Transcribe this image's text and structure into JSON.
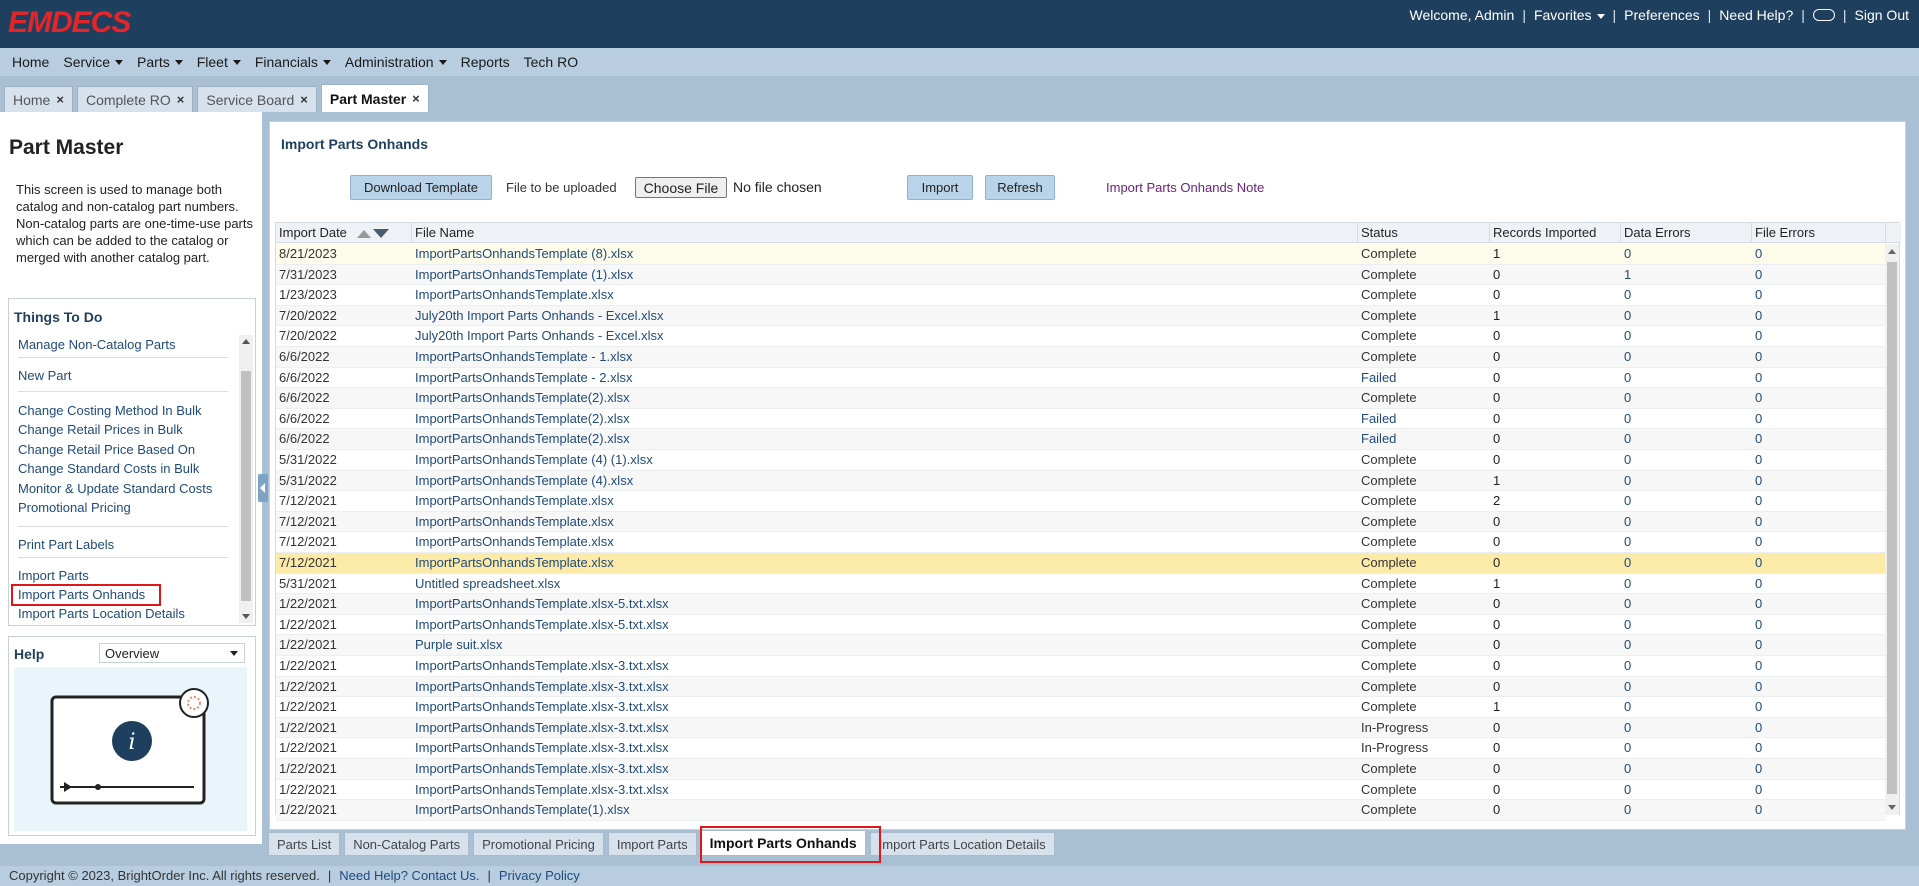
{
  "header": {
    "logo": "EMDECS",
    "welcome": "Welcome, Admin",
    "favorites": "Favorites",
    "preferences": "Preferences",
    "need_help": "Need Help?",
    "sign_out": "Sign Out"
  },
  "menu": [
    {
      "label": "Home",
      "dropdown": false
    },
    {
      "label": "Service",
      "dropdown": true
    },
    {
      "label": "Parts",
      "dropdown": true
    },
    {
      "label": "Fleet",
      "dropdown": true
    },
    {
      "label": "Financials",
      "dropdown": true
    },
    {
      "label": "Administration",
      "dropdown": true
    },
    {
      "label": "Reports",
      "dropdown": false
    },
    {
      "label": "Tech RO",
      "dropdown": false
    }
  ],
  "tabs": [
    {
      "label": "Home",
      "active": false
    },
    {
      "label": "Complete RO",
      "active": false
    },
    {
      "label": "Service Board",
      "active": false
    },
    {
      "label": "Part Master",
      "active": true
    }
  ],
  "left": {
    "title": "Part Master",
    "description": "This screen is used to manage both catalog and non-catalog part numbers. Non-catalog parts are one-time-use parts which can be added to the catalog or merged with another catalog part.",
    "todo_title": "Things To Do",
    "todo_items": [
      "Manage Non-Catalog Parts",
      "New Part",
      "Change Costing Method In Bulk",
      "Change Retail Prices in Bulk",
      "Change Retail Price Based On",
      "Change Standard Costs in Bulk",
      "Monitor & Update Standard Costs",
      "Promotional Pricing",
      "Print Part Labels",
      "Import Parts",
      "Import Parts Onhands",
      "Import Parts Location Details"
    ],
    "help_title": "Help",
    "help_select": "Overview"
  },
  "main": {
    "title": "Import Parts Onhands",
    "download_label": "Download Template",
    "file_label": "File to be uploaded",
    "choose_label": "Choose File",
    "no_file": "No file chosen",
    "import_label": "Import",
    "refresh_label": "Refresh",
    "note_label": "Import Parts Onhands Note"
  },
  "table": {
    "headers": [
      "Import Date",
      "File Name",
      "Status",
      "Records Imported",
      "Data Errors",
      "File Errors"
    ],
    "rows": [
      [
        "8/21/2023",
        "ImportPartsOnhandsTemplate (8).xlsx",
        "Complete",
        "1",
        "0",
        "0"
      ],
      [
        "7/31/2023",
        "ImportPartsOnhandsTemplate (1).xlsx",
        "Complete",
        "0",
        "1",
        "0"
      ],
      [
        "1/23/2023",
        "ImportPartsOnhandsTemplate.xlsx",
        "Complete",
        "0",
        "0",
        "0"
      ],
      [
        "7/20/2022",
        "July20th Import Parts Onhands - Excel.xlsx",
        "Complete",
        "1",
        "0",
        "0"
      ],
      [
        "7/20/2022",
        "July20th Import Parts Onhands - Excel.xlsx",
        "Complete",
        "0",
        "0",
        "0"
      ],
      [
        "6/6/2022",
        "ImportPartsOnhandsTemplate - 1.xlsx",
        "Complete",
        "0",
        "0",
        "0"
      ],
      [
        "6/6/2022",
        "ImportPartsOnhandsTemplate - 2.xlsx",
        "Failed",
        "0",
        "0",
        "0"
      ],
      [
        "6/6/2022",
        "ImportPartsOnhandsTemplate(2).xlsx",
        "Complete",
        "0",
        "0",
        "0"
      ],
      [
        "6/6/2022",
        "ImportPartsOnhandsTemplate(2).xlsx",
        "Failed",
        "0",
        "0",
        "0"
      ],
      [
        "6/6/2022",
        "ImportPartsOnhandsTemplate(2).xlsx",
        "Failed",
        "0",
        "0",
        "0"
      ],
      [
        "5/31/2022",
        "ImportPartsOnhandsTemplate (4) (1).xlsx",
        "Complete",
        "0",
        "0",
        "0"
      ],
      [
        "5/31/2022",
        "ImportPartsOnhandsTemplate (4).xlsx",
        "Complete",
        "1",
        "0",
        "0"
      ],
      [
        "7/12/2021",
        "ImportPartsOnhandsTemplate.xlsx",
        "Complete",
        "2",
        "0",
        "0"
      ],
      [
        "7/12/2021",
        "ImportPartsOnhandsTemplate.xlsx",
        "Complete",
        "0",
        "0",
        "0"
      ],
      [
        "7/12/2021",
        "ImportPartsOnhandsTemplate.xlsx",
        "Complete",
        "0",
        "0",
        "0"
      ],
      [
        "7/12/2021",
        "ImportPartsOnhandsTemplate.xlsx",
        "Complete",
        "0",
        "0",
        "0"
      ],
      [
        "5/31/2021",
        "Untitled spreadsheet.xlsx",
        "Complete",
        "1",
        "0",
        "0"
      ],
      [
        "1/22/2021",
        "ImportPartsOnhandsTemplate.xlsx-5.txt.xlsx",
        "Complete",
        "0",
        "0",
        "0"
      ],
      [
        "1/22/2021",
        "ImportPartsOnhandsTemplate.xlsx-5.txt.xlsx",
        "Complete",
        "0",
        "0",
        "0"
      ],
      [
        "1/22/2021",
        "Purple suit.xlsx",
        "Complete",
        "0",
        "0",
        "0"
      ],
      [
        "1/22/2021",
        "ImportPartsOnhandsTemplate.xlsx-3.txt.xlsx",
        "Complete",
        "0",
        "0",
        "0"
      ],
      [
        "1/22/2021",
        "ImportPartsOnhandsTemplate.xlsx-3.txt.xlsx",
        "Complete",
        "0",
        "0",
        "0"
      ],
      [
        "1/22/2021",
        "ImportPartsOnhandsTemplate.xlsx-3.txt.xlsx",
        "Complete",
        "1",
        "0",
        "0"
      ],
      [
        "1/22/2021",
        "ImportPartsOnhandsTemplate.xlsx-3.txt.xlsx",
        "In-Progress",
        "0",
        "0",
        "0"
      ],
      [
        "1/22/2021",
        "ImportPartsOnhandsTemplate.xlsx-3.txt.xlsx",
        "In-Progress",
        "0",
        "0",
        "0"
      ],
      [
        "1/22/2021",
        "ImportPartsOnhandsTemplate.xlsx-3.txt.xlsx",
        "Complete",
        "0",
        "0",
        "0"
      ],
      [
        "1/22/2021",
        "ImportPartsOnhandsTemplate.xlsx-3.txt.xlsx",
        "Complete",
        "0",
        "0",
        "0"
      ],
      [
        "1/22/2021",
        "ImportPartsOnhandsTemplate(1).xlsx",
        "Complete",
        "0",
        "0",
        "0"
      ]
    ]
  },
  "bottom_tabs": [
    {
      "label": "Parts List",
      "active": false
    },
    {
      "label": "Non-Catalog Parts",
      "active": false
    },
    {
      "label": "Promotional Pricing",
      "active": false
    },
    {
      "label": "Import Parts",
      "active": false
    },
    {
      "label": "Import Parts Onhands",
      "active": true
    },
    {
      "label": "Import Parts Location Details",
      "active": false
    }
  ],
  "footer": {
    "copyright": "Copyright © 2023, BrightOrder Inc. All rights reserved.",
    "help_link": "Need Help? Contact Us.",
    "privacy_link": "Privacy Policy"
  }
}
